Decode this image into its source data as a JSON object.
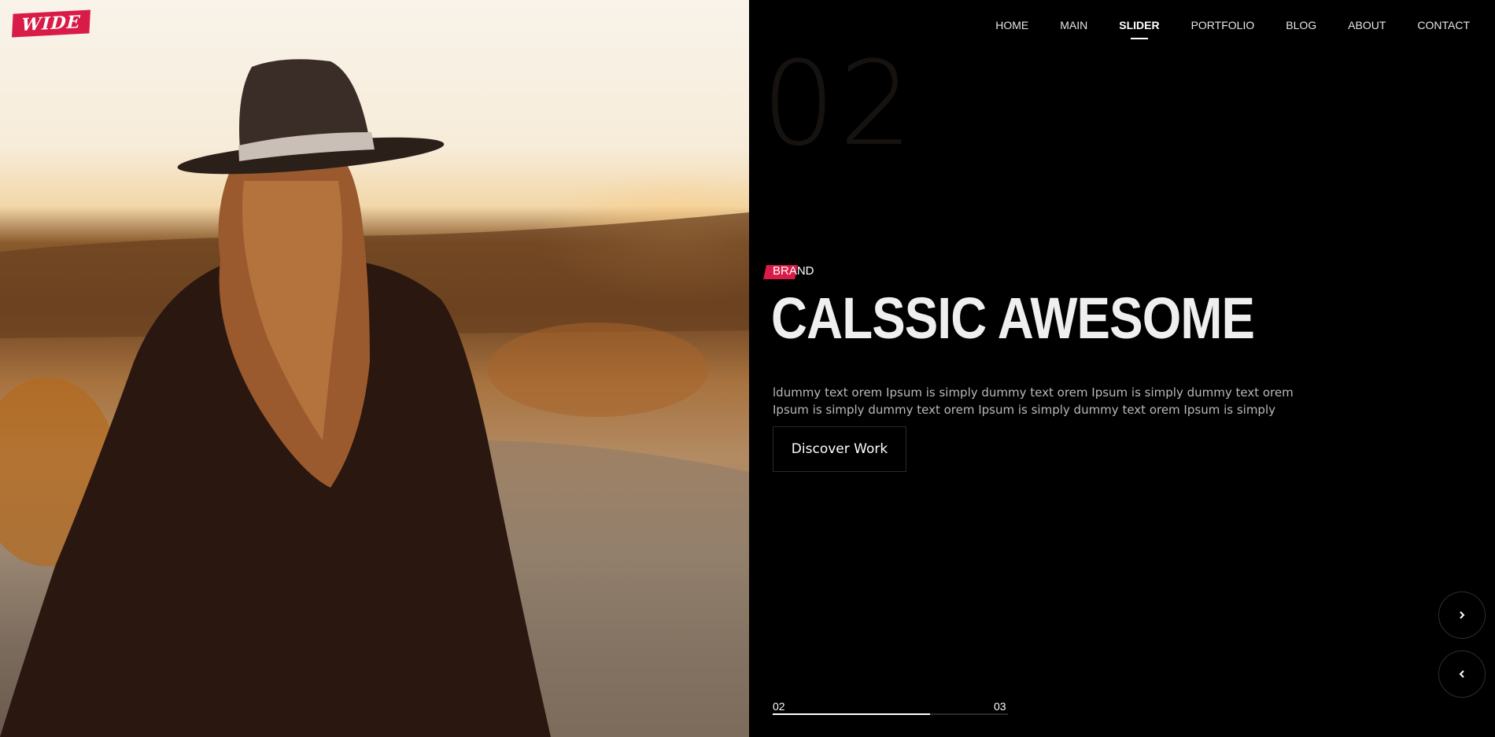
{
  "logo": {
    "text": "WIDE"
  },
  "nav": {
    "items": [
      "HOME",
      "MAIN",
      "SLIDER",
      "PORTFOLIO",
      "BLOG",
      "ABOUT",
      "CONTACT"
    ],
    "active": "SLIDER"
  },
  "slide": {
    "number": "02",
    "brand": "BRAND",
    "title": "CALSSIC AWESOME",
    "description": "ldummy text orem Ipsum is simply dummy text orem Ipsum is simply dummy text orem Ipsum is simply dummy text orem Ipsum is simply dummy text orem Ipsum is simply",
    "button_label": "Discover Work"
  },
  "pager": {
    "current": "02",
    "next": "03",
    "progress": 0.67
  },
  "controls": {
    "next_icon": "chevron-right-icon",
    "prev_icon": "chevron-left-icon"
  },
  "colors": {
    "accent": "#d81b47",
    "background": "#000000",
    "text": "#ffffff"
  }
}
